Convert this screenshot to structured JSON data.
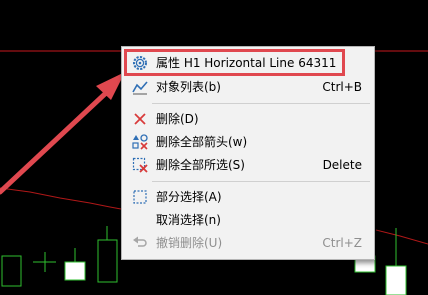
{
  "colors": {
    "background": "#000000",
    "horizontal_line": "#c8191e",
    "indicator_line": "#b01818",
    "arrow": "#e0484f",
    "candle": "#2fbf2f"
  },
  "context_menu": {
    "items": [
      {
        "icon": "gear-icon",
        "label": "属性 H1 Horizontal Line 64311",
        "shortcut": "",
        "enabled": true
      },
      {
        "icon": "object-list-icon",
        "label": "对象列表(b)",
        "shortcut": "Ctrl+B",
        "enabled": true
      },
      {
        "icon": "delete-x-icon",
        "label": "删除(D)",
        "shortcut": "",
        "enabled": true
      },
      {
        "icon": "delete-arrows-icon",
        "label": "删除全部箭头(w)",
        "shortcut": "",
        "enabled": true
      },
      {
        "icon": "delete-selected-icon",
        "label": "删除全部所选(S)",
        "shortcut": "Delete",
        "enabled": true
      },
      {
        "icon": "partial-select-icon",
        "label": "部分选择(A)",
        "shortcut": "",
        "enabled": true
      },
      {
        "icon": "",
        "label": "取消选择(n)",
        "shortcut": "",
        "enabled": true
      },
      {
        "icon": "undo-icon",
        "label": "撤销删除(U)",
        "shortcut": "Ctrl+Z",
        "enabled": false
      }
    ]
  }
}
